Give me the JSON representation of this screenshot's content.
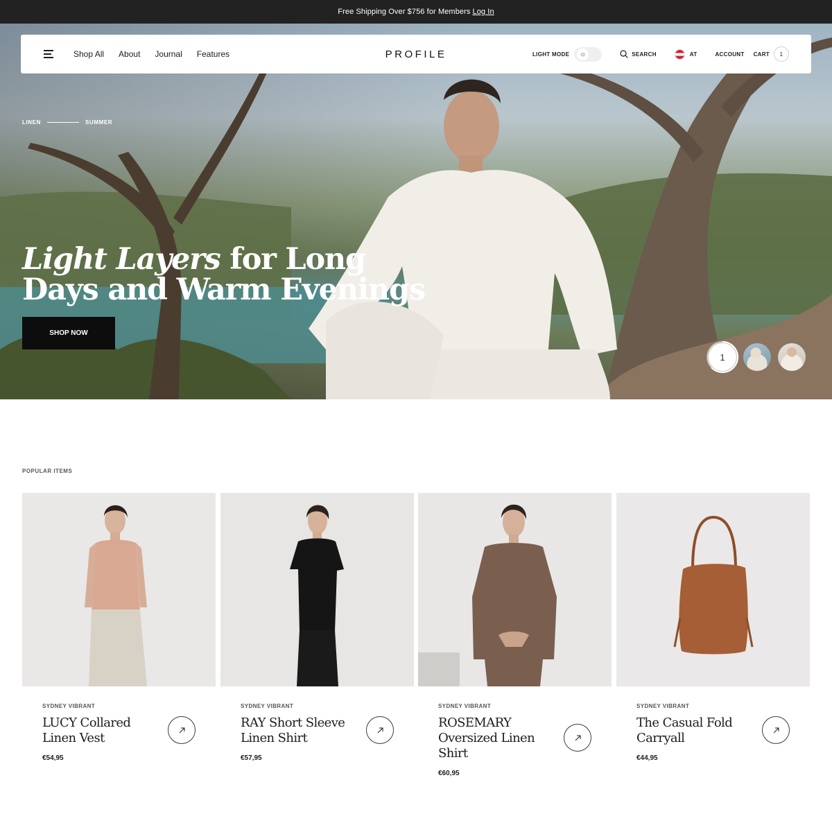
{
  "announcement": {
    "text": "Free Shipping Over $756 for Members",
    "link_label": "Log In"
  },
  "header": {
    "nav": [
      "Shop All",
      "About",
      "Journal",
      "Features"
    ],
    "logo": "PROFILE",
    "light_mode_label": "LIGHT MODE",
    "search_label": "SEARCH",
    "locale_label": "AT",
    "account_label": "ACCOUNT",
    "cart_label": "CART",
    "cart_count": "1"
  },
  "hero": {
    "tag_left": "LINEN",
    "tag_right": "SUMMER",
    "title_italic": "Light Layers",
    "title_rest": " for Long Days and Warm Evenings",
    "cta_label": "SHOP NOW",
    "active_slide": "1"
  },
  "popular": {
    "label": "POPULAR ITEMS",
    "items": [
      {
        "brand": "SYDNEY VIBRANT",
        "name": "LUCY Collared Linen Vest",
        "price": "€54,95"
      },
      {
        "brand": "SYDNEY VIBRANT",
        "name": "RAY Short Sleeve Linen Shirt",
        "price": "€57,95"
      },
      {
        "brand": "SYDNEY VIBRANT",
        "name": "ROSEMARY Oversized Linen Shirt",
        "price": "€60,95"
      },
      {
        "brand": "SYDNEY VIBRANT",
        "name": "The Casual Fold Carryall",
        "price": "€44,95"
      }
    ]
  },
  "colors": {
    "announce_bg": "#222222",
    "cta_bg": "#0d0d0d",
    "card_bg": "#e9e8e7"
  }
}
